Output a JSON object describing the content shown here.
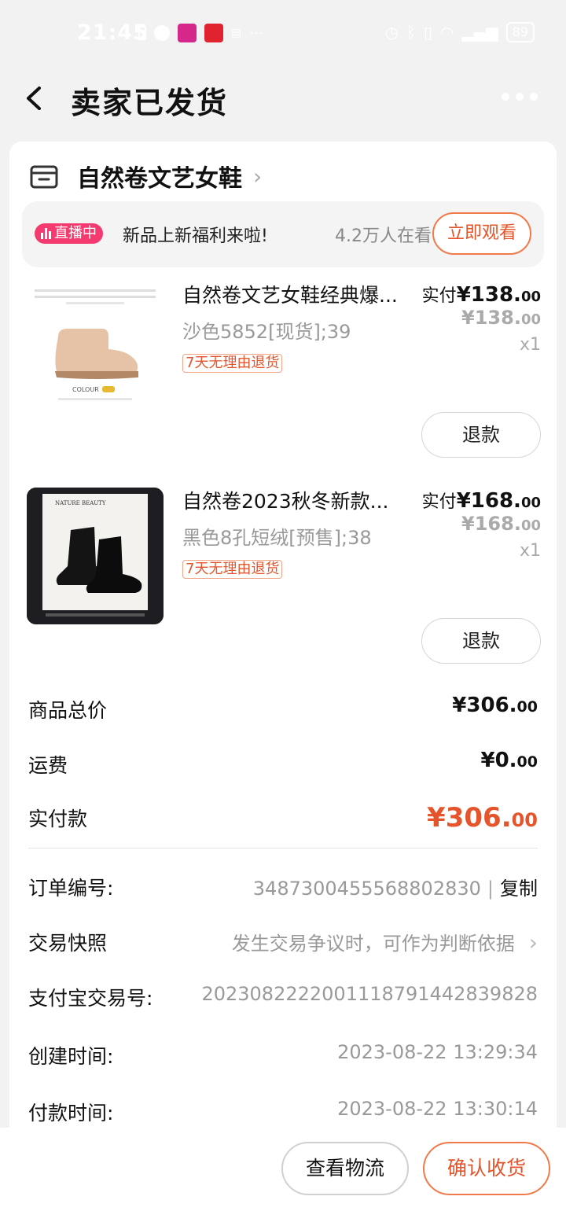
{
  "status_bar": {
    "time": "21:45",
    "notification_labels": [
      "唯品会",
      "拼多多"
    ],
    "battery": "89",
    "network": "4G"
  },
  "nav": {
    "title": "卖家已发货"
  },
  "shop": {
    "name": "自然卷文艺女鞋"
  },
  "live": {
    "badge": "直播中",
    "text": "新品上新福利来啦!",
    "viewers": "4.2万人在看",
    "button": "立即观看"
  },
  "items": [
    {
      "title": "自然卷文艺女鞋经典爆...",
      "spec": "沙色5852[现货];39",
      "tag": "7天无理由退货",
      "pay_label": "实付",
      "pay_int": "¥138.",
      "pay_dec": "00",
      "orig_int": "¥138.",
      "orig_dec": "00",
      "qty": "x1",
      "refund": "退款",
      "thumb_colour_label": "COLOUR"
    },
    {
      "title": "自然卷2023秋冬新款...",
      "spec": "黑色8孔短绒[预售];38",
      "tag": "7天无理由退货",
      "pay_label": "实付",
      "pay_int": "¥168.",
      "pay_dec": "00",
      "orig_int": "¥168.",
      "orig_dec": "00",
      "qty": "x1",
      "refund": "退款",
      "thumb_brand": "NATURE BEAUTY"
    }
  ],
  "summary": {
    "goods_total_label": "商品总价",
    "goods_total_int": "¥306.",
    "goods_total_dec": "00",
    "shipping_label": "运费",
    "shipping_int": "¥0.",
    "shipping_dec": "00",
    "paid_label": "实付款",
    "paid_int": "¥306.",
    "paid_dec": "00"
  },
  "order_info": {
    "order_no_label": "订单编号:",
    "order_no": "3487300455568802830",
    "copy": "复制",
    "snapshot_label": "交易快照",
    "snapshot_value": "发生交易争议时，可作为判断依据",
    "alipay_label": "支付宝交易号:",
    "alipay_no": "2023082222001118791442839828",
    "created_label": "创建时间:",
    "created_time": "2023-08-22 13:29:34",
    "paid_label": "付款时间:",
    "paid_time": "2023-08-22 13:30:14"
  },
  "bottom_bar": {
    "logistics": "查看物流",
    "confirm": "确认收货"
  },
  "colors": {
    "accent": "#e5542a",
    "live_badge": "#f43a6e",
    "muted": "#999999"
  }
}
